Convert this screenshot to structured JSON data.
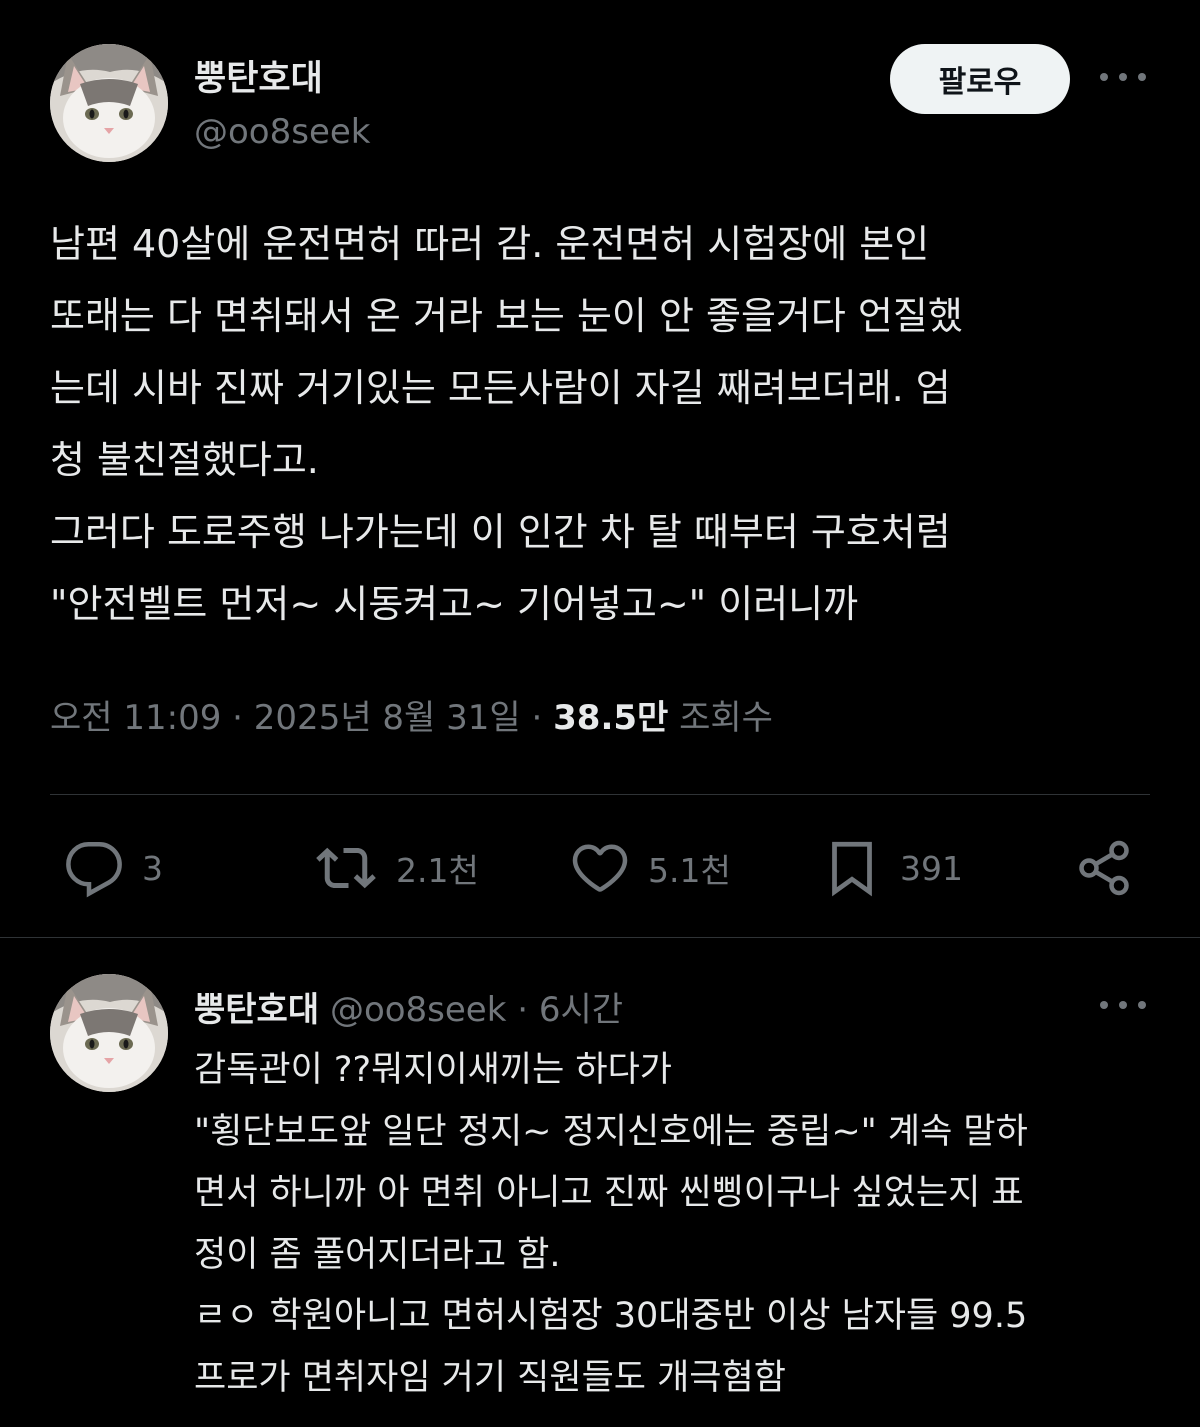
{
  "tweet": {
    "author_name": "뿡탄호대",
    "author_handle": "@oo8seek",
    "follow_label": "팔로우",
    "text_lines": [
      "남편 40살에 운전면허 따러 감. 운전면허 시험장에 본인",
      "또래는 다 면취돼서 온 거라 보는 눈이 안 좋을거다 언질했",
      "는데 시바 진짜 거기있는 모든사람이 자길 째려보더래. 엄",
      "청 불친절했다고.",
      "그러다 도로주행 나가는데 이 인간 차 탈 때부터 구호처럼",
      "\"안전벨트 먼저~ 시동켜고~  기어넣고~\" 이러니까"
    ],
    "time": "오전 11:09",
    "date": "2025년 8월 31일",
    "separator": "·",
    "views_count": "38.5만",
    "views_label": "조회수"
  },
  "actions": {
    "reply_count": "3",
    "retweet_count": "2.1천",
    "like_count": "5.1천",
    "bookmark_count": "391"
  },
  "reply": {
    "author_name": "뿡탄호대",
    "author_handle": "@oo8seek",
    "separator": "·",
    "time_ago": "6시간",
    "text_lines": [
      "감독관이 ??뭐지이새끼는 하다가",
      "\"횡단보도앞 일단 정지~ 정지신호에는 중립~\" 계속 말하",
      "면서 하니까 아 면취 아니고 진짜 씬삥이구나 싶었는지 표",
      "정이 좀 풀어지더라고 함.",
      "ㄹㅇ 학원아니고 면허시험장 30대중반 이상 남자들 99.5",
      "프로가 면취자임 거기 직원들도 개극혐함"
    ]
  },
  "colors": {
    "background": "#000000",
    "text_primary": "#e7e9ea",
    "text_secondary": "#71767b",
    "follow_button_bg": "#eff3f4",
    "divider": "#2f3336"
  },
  "icons": [
    "reply-icon",
    "retweet-icon",
    "like-icon",
    "bookmark-icon",
    "share-icon",
    "more-icon"
  ]
}
